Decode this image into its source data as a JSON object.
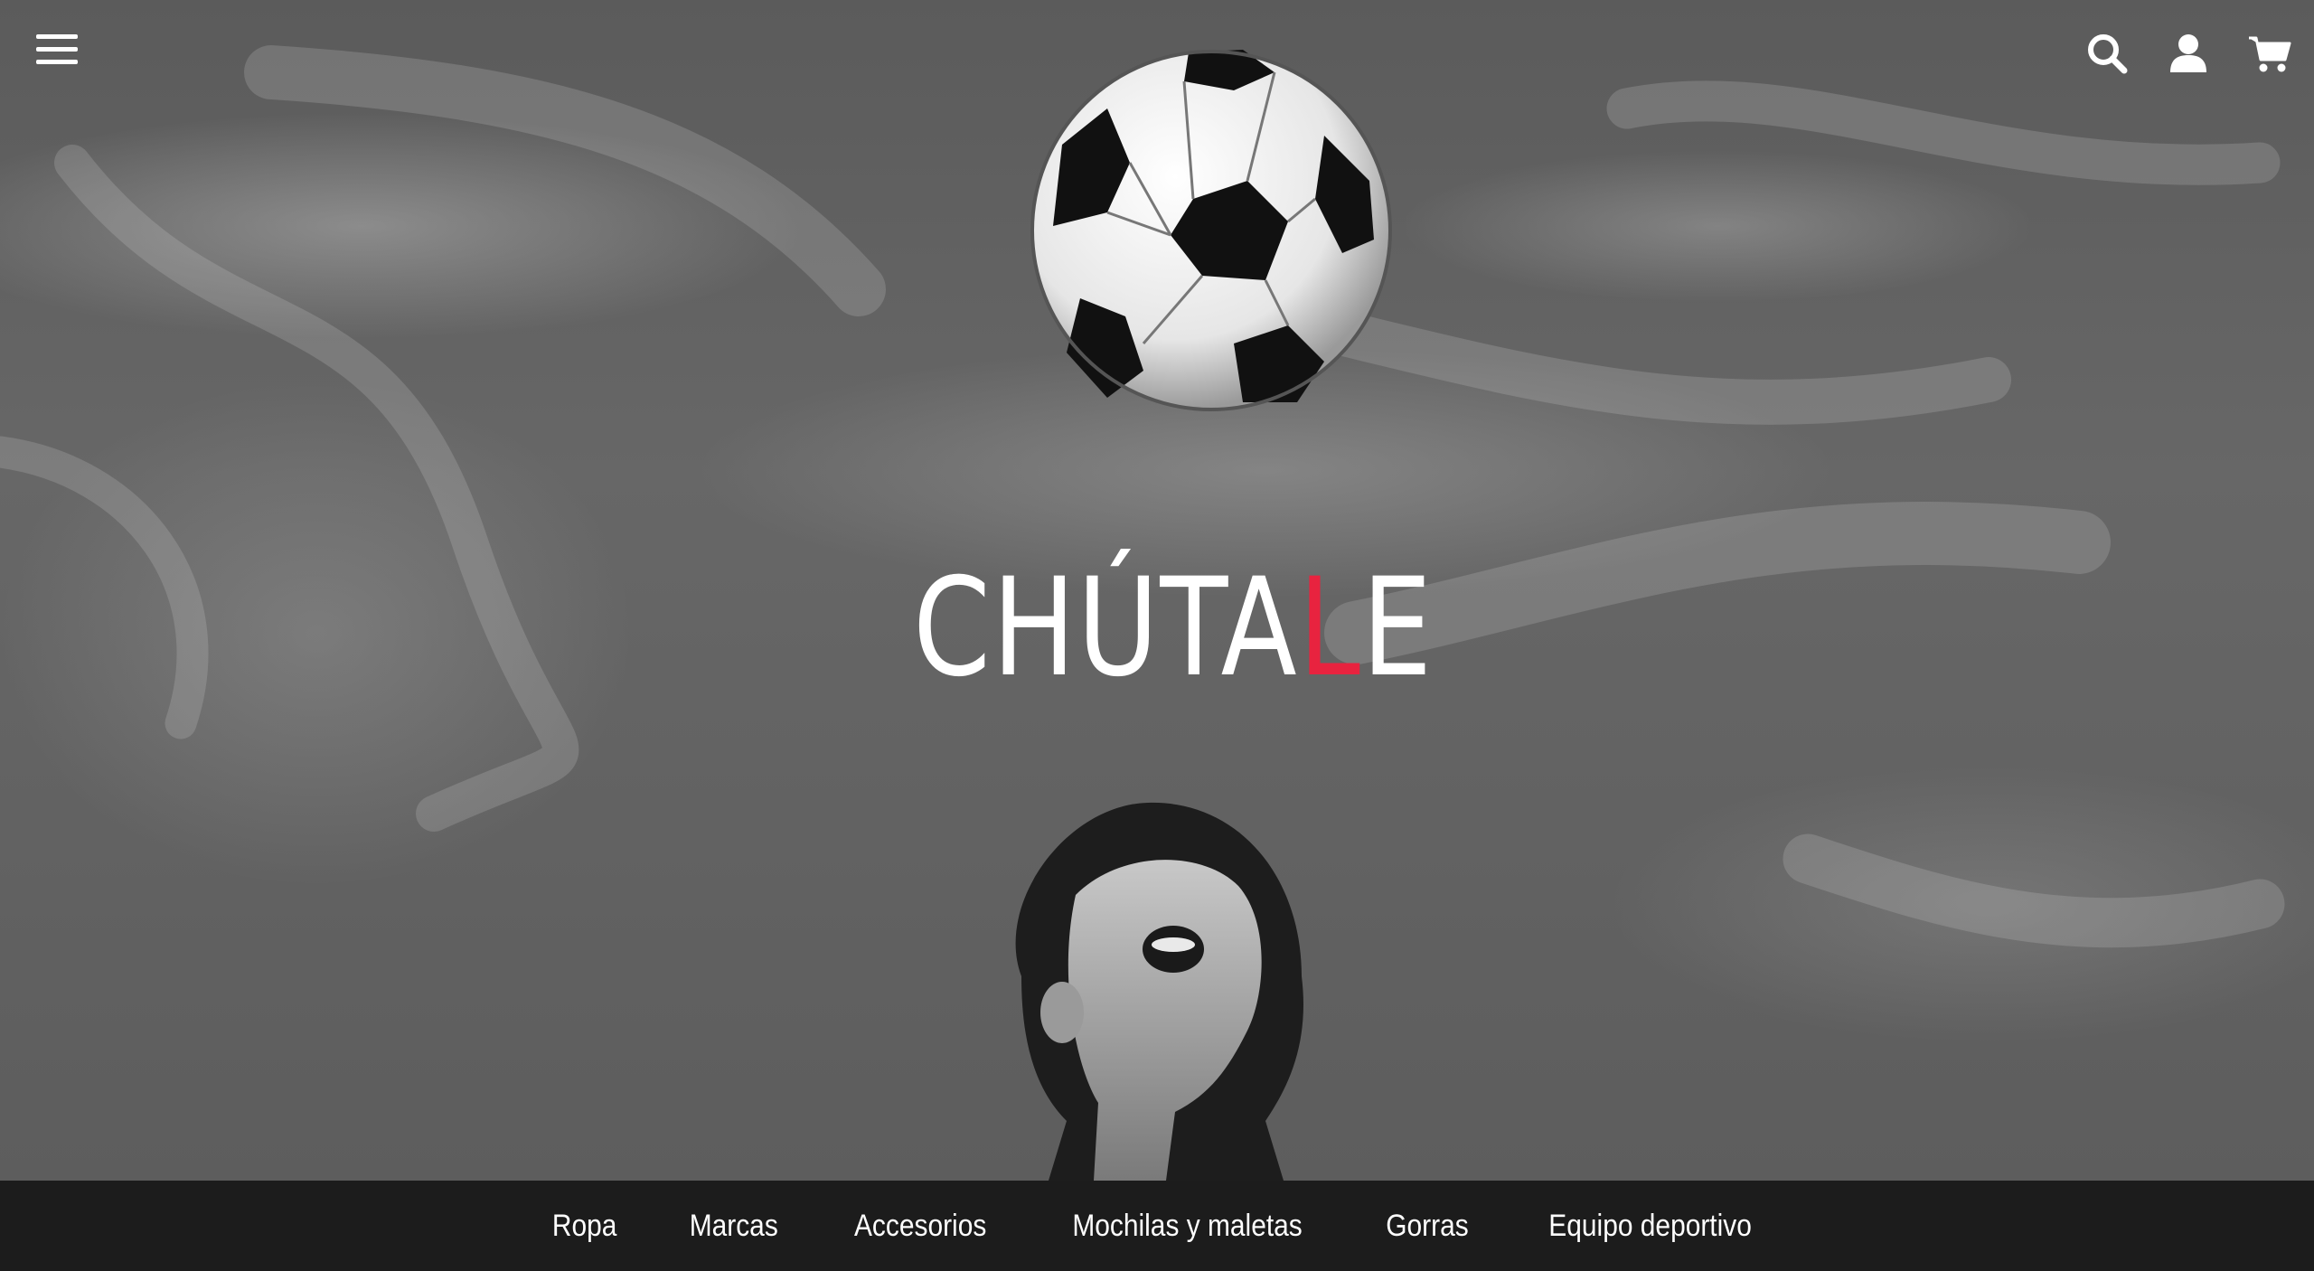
{
  "header": {
    "menu_icon": "menu-icon",
    "actions": [
      {
        "name": "search",
        "icon": "search-icon"
      },
      {
        "name": "account",
        "icon": "user-icon"
      },
      {
        "name": "cart",
        "icon": "cart-icon"
      }
    ]
  },
  "hero": {
    "logo_text_main": "CHÚTA",
    "logo_text_accent": "L",
    "logo_text_end": "E",
    "accent_color": "#e8233f"
  },
  "nav": {
    "items": [
      "Ropa",
      "Marcas",
      "Accesorios",
      "Mochilas y maletas",
      "Gorras",
      "Equipo deportivo"
    ]
  }
}
